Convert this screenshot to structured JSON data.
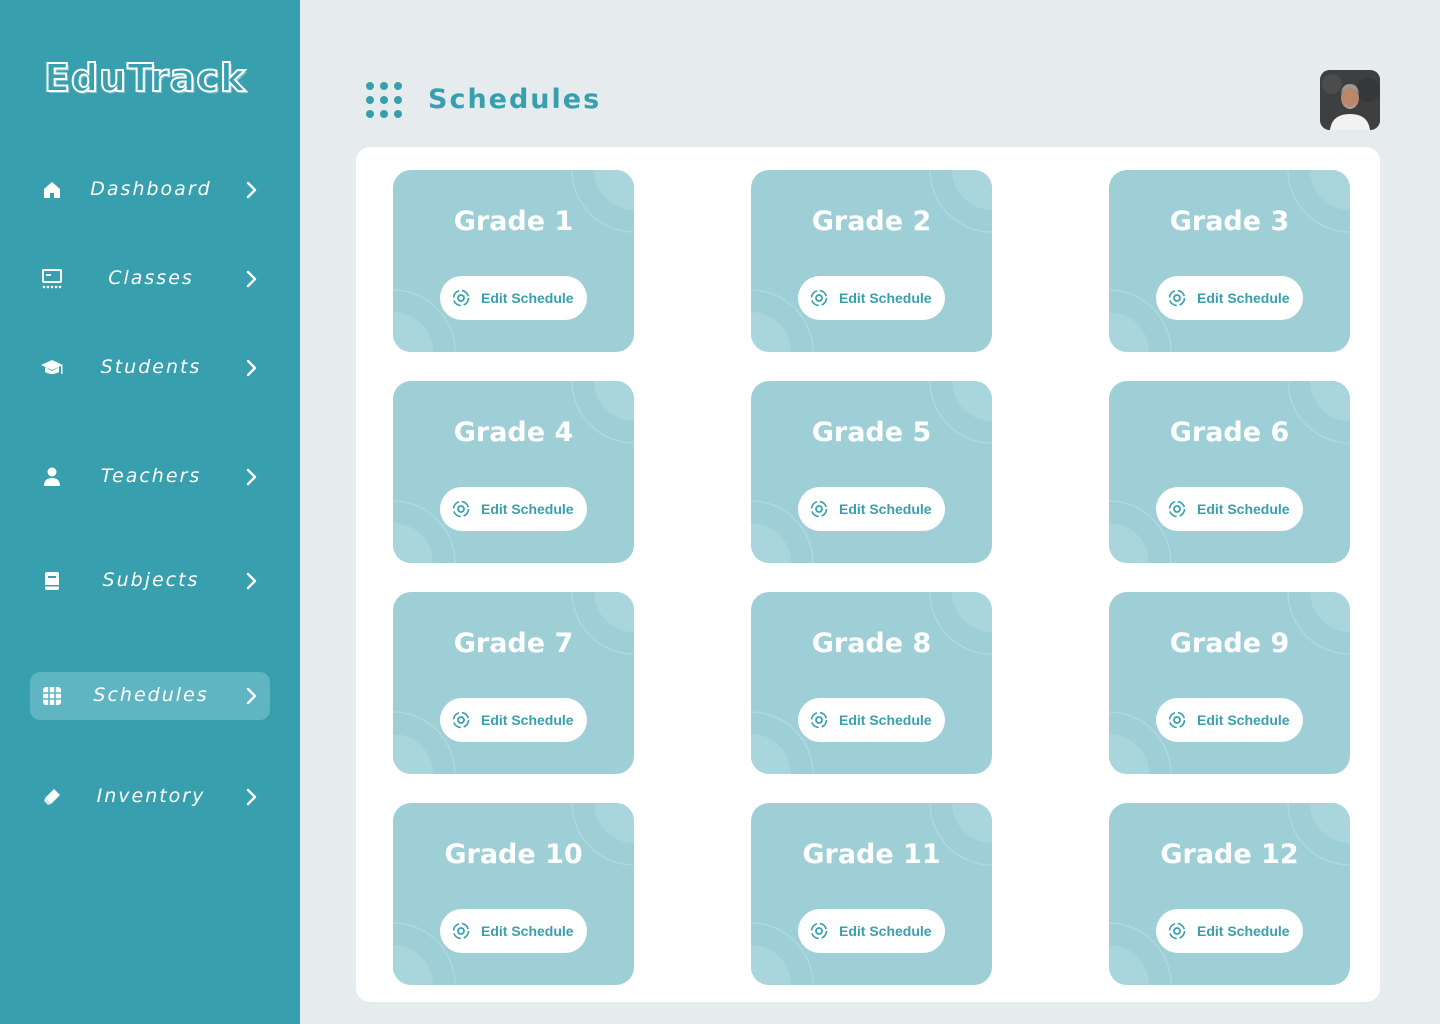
{
  "app": {
    "logo": "EduTrack"
  },
  "sidebar": {
    "items": [
      {
        "label": "Dashboard",
        "icon": "home-icon",
        "active": false
      },
      {
        "label": "Classes",
        "icon": "classroom-icon",
        "active": false
      },
      {
        "label": "Students",
        "icon": "graduation-cap-icon",
        "active": false
      },
      {
        "label": "Teachers",
        "icon": "user-icon",
        "active": false
      },
      {
        "label": "Subjects",
        "icon": "book-icon",
        "active": false
      },
      {
        "label": "Schedules",
        "icon": "grid-icon",
        "active": true
      },
      {
        "label": "Inventory",
        "icon": "eraser-icon",
        "active": false
      }
    ]
  },
  "header": {
    "title": "Schedules",
    "icon": "dots-grid-icon",
    "avatar": "user-avatar"
  },
  "grades": [
    {
      "title": "Grade 1",
      "button": "Edit Schedule"
    },
    {
      "title": "Grade 2",
      "button": "Edit Schedule"
    },
    {
      "title": "Grade 3",
      "button": "Edit Schedule"
    },
    {
      "title": "Grade 4",
      "button": "Edit Schedule"
    },
    {
      "title": "Grade 5",
      "button": "Edit Schedule"
    },
    {
      "title": "Grade 6",
      "button": "Edit Schedule"
    },
    {
      "title": "Grade 7",
      "button": "Edit Schedule"
    },
    {
      "title": "Grade 8",
      "button": "Edit Schedule"
    },
    {
      "title": "Grade 9",
      "button": "Edit Schedule"
    },
    {
      "title": "Grade 10",
      "button": "Edit Schedule"
    },
    {
      "title": "Grade 11",
      "button": "Edit Schedule"
    },
    {
      "title": "Grade 12",
      "button": "Edit Schedule"
    }
  ],
  "colors": {
    "sidebar": "#389faf",
    "accent": "#389faf",
    "card": "#9ecfd6",
    "active_nav": "#5fb5c2",
    "background": "#e6ebee"
  }
}
